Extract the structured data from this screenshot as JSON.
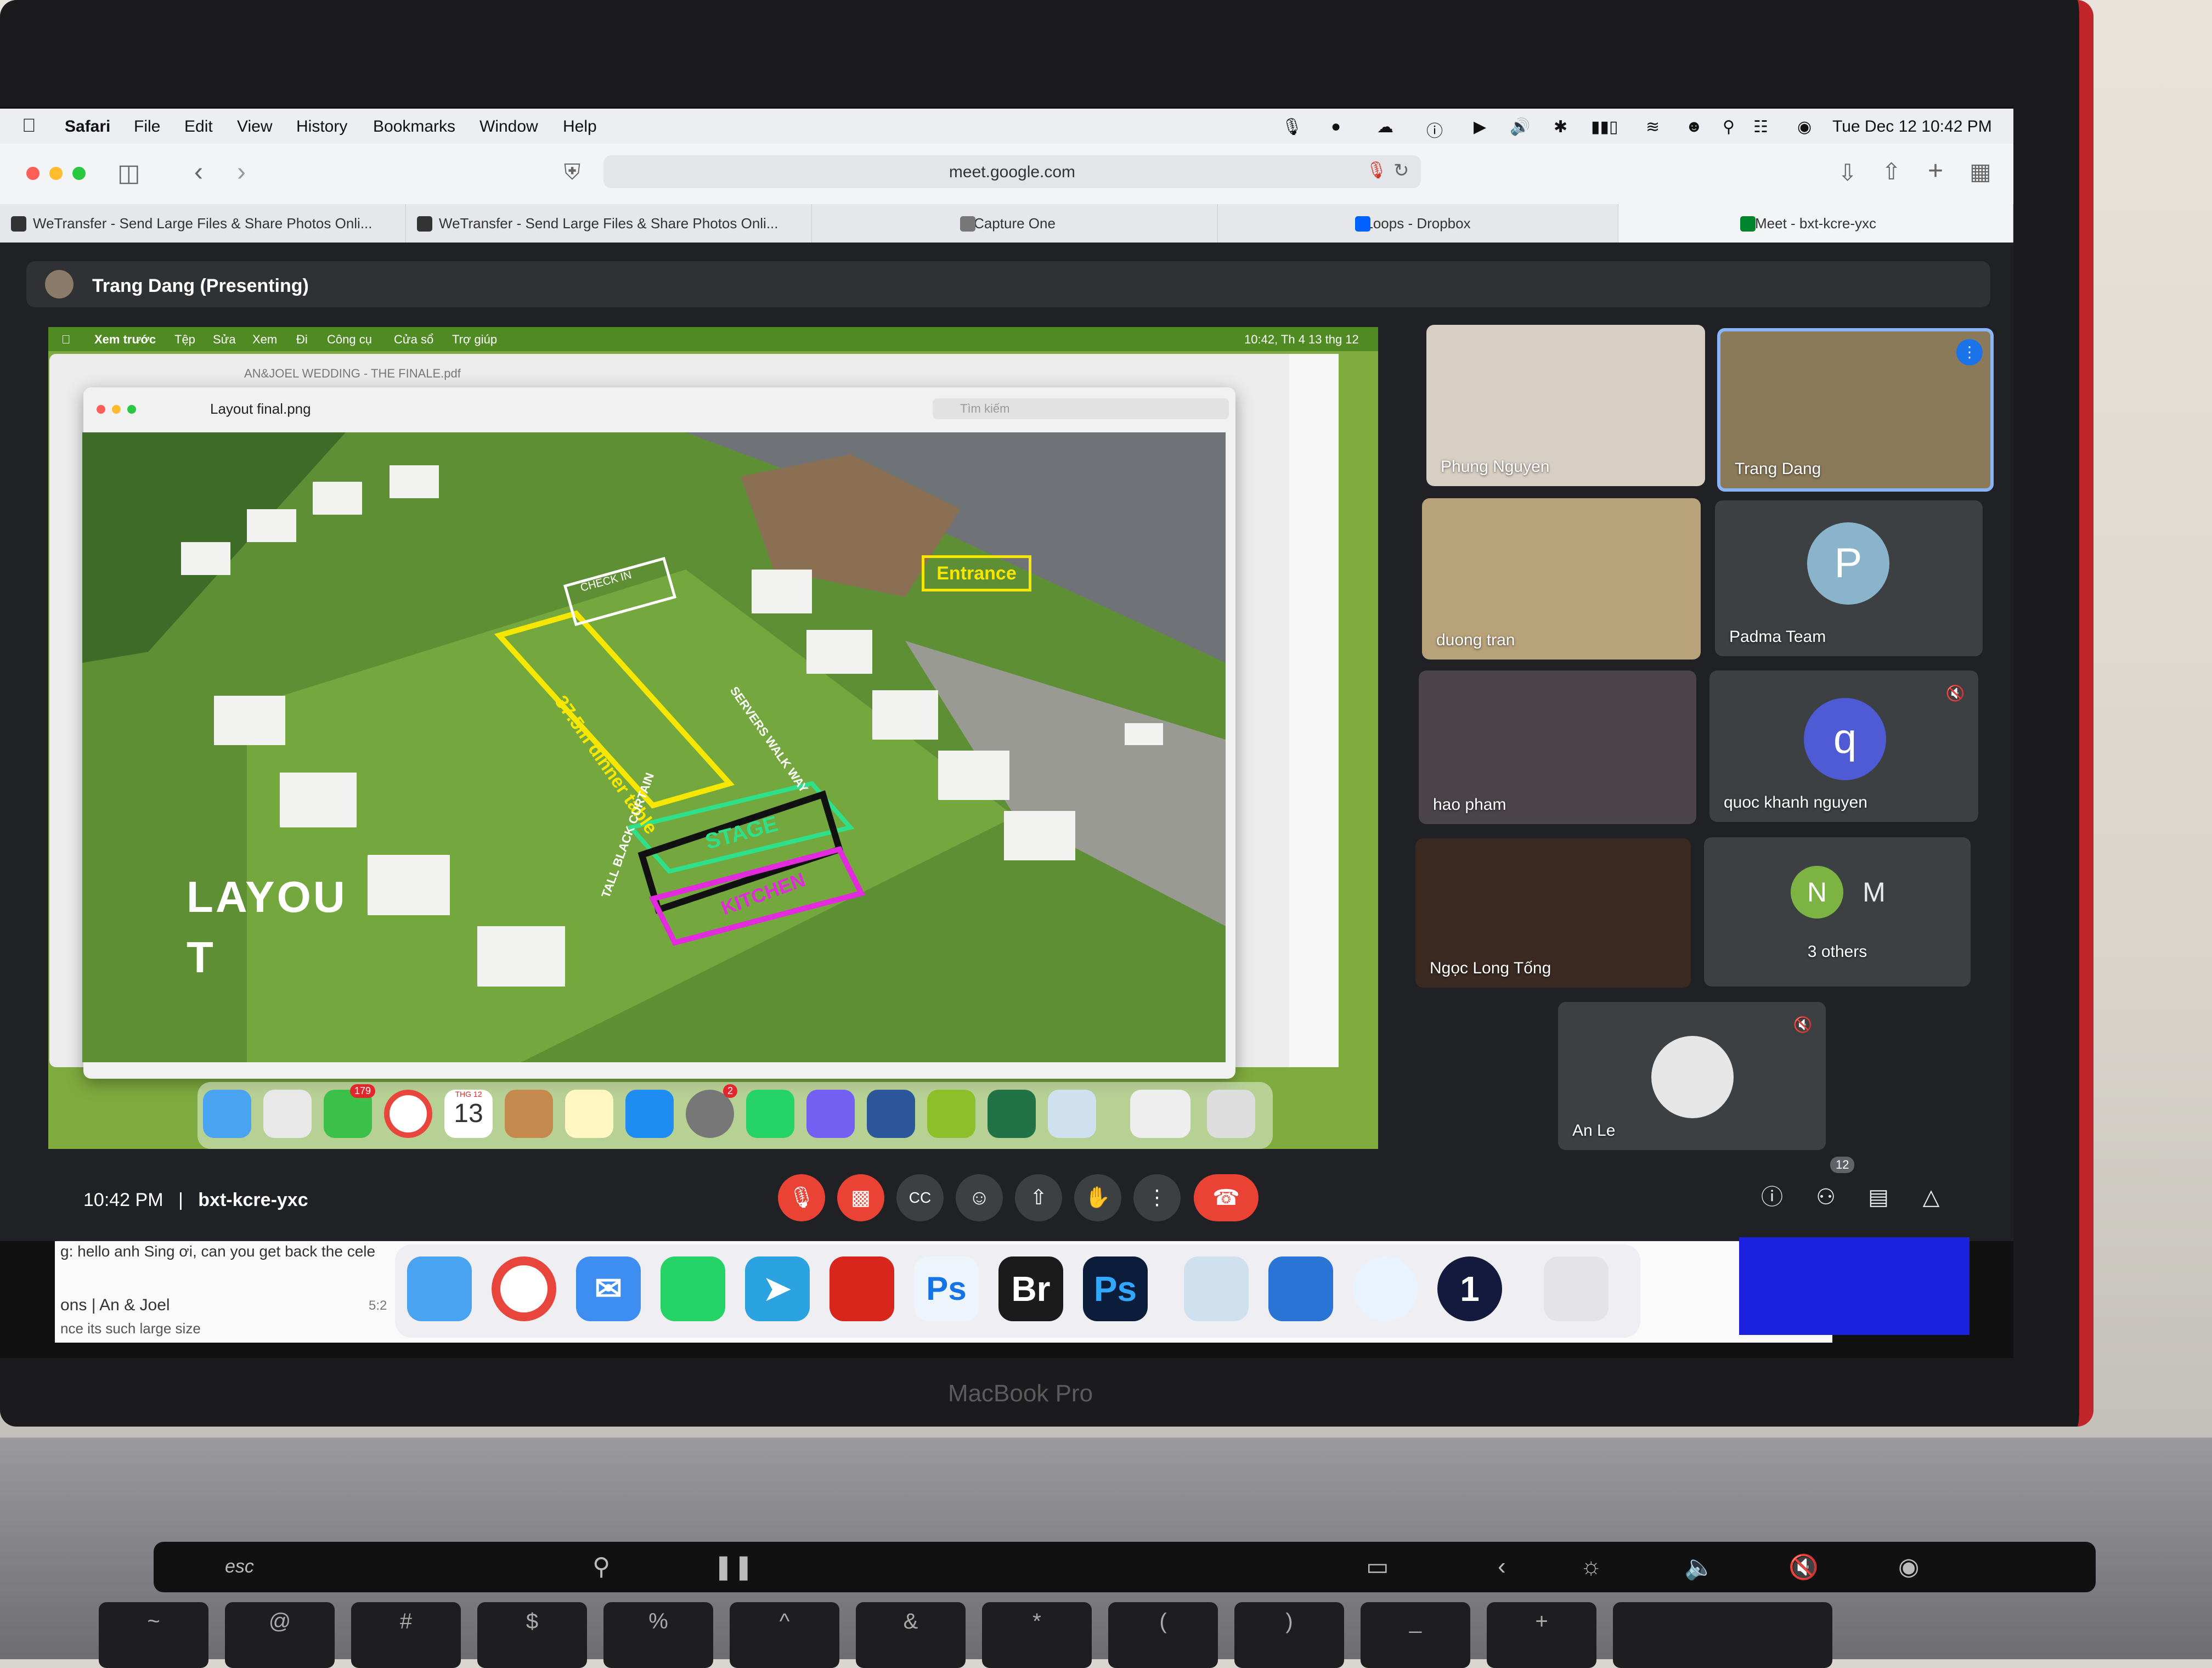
{
  "menubar": {
    "app": "Safari",
    "items": [
      "File",
      "Edit",
      "View",
      "History",
      "Bookmarks",
      "Window",
      "Help"
    ],
    "datetime": "Tue Dec 12  10:42 PM"
  },
  "browser": {
    "url": "meet.google.com",
    "tabs": [
      {
        "label": "WeTransfer - Send Large Files & Share Photos Onli...",
        "icon": "wetransfer-icon"
      },
      {
        "label": "WeTransfer - Send Large Files & Share Photos Onli...",
        "icon": "wetransfer-icon"
      },
      {
        "label": "Capture One",
        "icon": "capture-one-icon"
      },
      {
        "label": "Loops - Dropbox",
        "icon": "dropbox-icon"
      },
      {
        "label": "Meet - bxt-kcre-yxc",
        "icon": "meet-icon"
      }
    ]
  },
  "meet": {
    "presenting_label": "Trang Dang (Presenting)",
    "time": "10:42 PM",
    "separator": "|",
    "meeting_code": "bxt-kcre-yxc",
    "people_count": "12",
    "participants": [
      {
        "name": "Phung Nguyen"
      },
      {
        "name": "Trang Dang"
      },
      {
        "name": "duong tran"
      },
      {
        "name": "Padma Team",
        "initial": "P"
      },
      {
        "name": "hao pham"
      },
      {
        "name": "quoc khanh nguyen",
        "initial": "q"
      },
      {
        "name": "Ngọc Long Tống"
      },
      {
        "name": "3 others",
        "initial": "N",
        "second_initial": "M"
      },
      {
        "name": "An Le"
      }
    ]
  },
  "shared_screen": {
    "menu": [
      "Xem trước",
      "Tệp",
      "Sửa",
      "Xem",
      "Đi",
      "Công cụ",
      "Cửa sổ",
      "Trợ giúp"
    ],
    "clock": "10:42, Th 4 13 thg 12",
    "pdf_title": "AN&JOEL WEDDING - THE FINALE.pdf",
    "preview_title": "Layout final.png",
    "search_placeholder": "Tìm kiếm",
    "layout_label_1": "LAYOU",
    "layout_label_2": "T",
    "entrance_label": "Entrance",
    "dinner_table_label": "37.5m dinner table",
    "servers_label": "SERVERS WALK WAY",
    "stage_label": "STAGE",
    "kitchen_label": "KITCHEN",
    "curtain_label": "TALL BLACK CURTAIN",
    "calendar_month": "THG 12",
    "calendar_day": "13",
    "messages_badge": "179",
    "settings_badge": "2",
    "tag_label": "CHECK IN"
  },
  "background_window": {
    "line1": "g: hello anh Sing ơi, can you get back the cele",
    "line2": "ons | An & Joel",
    "line3": "nce its such large size",
    "time": "5:2"
  },
  "laptop": {
    "model": "MacBook Pro",
    "esc": "esc"
  },
  "colors": {
    "meet_bg": "#202124",
    "hangup_red": "#ea4335",
    "active_speaker_blue": "#8ab4f8",
    "laptop_red": "#c0262a"
  }
}
